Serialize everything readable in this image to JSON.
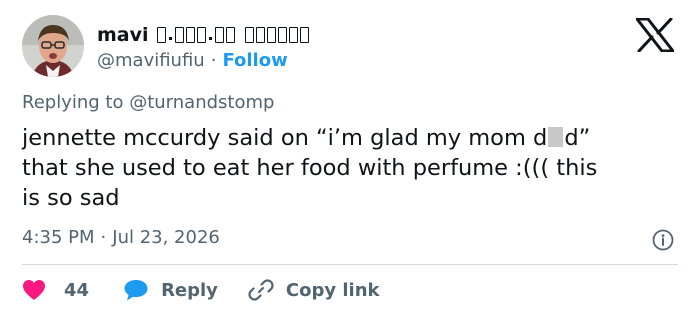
{
  "user": {
    "display_name": "mavi",
    "handle": "@mavifiufiu",
    "separator": "·",
    "follow_label": "Follow"
  },
  "reply": {
    "prefix": "Replying to",
    "target": "@turnandstomp"
  },
  "tweet": {
    "line1_before": "jennette mccurdy said on “i’m glad my mom d",
    "line1_after": "d”",
    "line2": "that she used to eat her food with perfume :((( this",
    "line3": "is so sad"
  },
  "meta": {
    "time": "4:35 PM",
    "separator": "·",
    "date": "Jul 23, 2026"
  },
  "actions": {
    "like_count": "44",
    "reply_label": "Reply",
    "copy_link_label": "Copy link"
  },
  "icons": {
    "brand": "x-logo-icon",
    "info": "info-icon",
    "like": "heart-icon",
    "reply": "speech-bubble-icon",
    "copy": "link-icon"
  },
  "colors": {
    "text": "#0f1419",
    "secondary": "#536471",
    "link": "#1d9bf0",
    "like": "#f91880",
    "divider": "#cfd9de"
  }
}
